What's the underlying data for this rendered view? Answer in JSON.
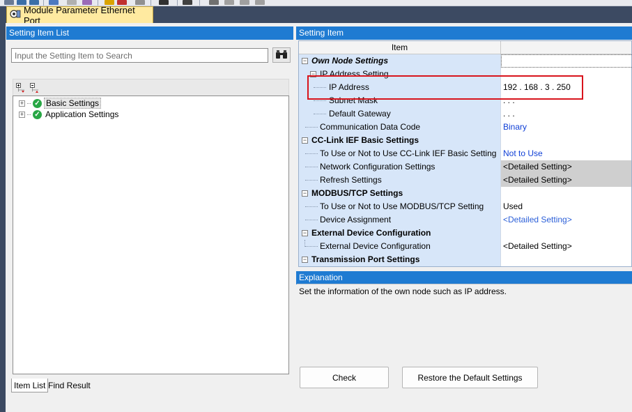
{
  "doc_tab": {
    "title": "Module Parameter Ethernet Port",
    "icon": "module-parameter-icon"
  },
  "left_panel": {
    "header": "Setting Item List",
    "search": {
      "placeholder": "Input the Setting Item to Search",
      "value": ""
    },
    "tree": [
      {
        "label": "Basic Settings",
        "selected": true
      },
      {
        "label": "Application Settings",
        "selected": false
      }
    ],
    "bottom_tabs": [
      {
        "label": "Item List",
        "active": true
      },
      {
        "label": "Find Result",
        "active": false
      }
    ]
  },
  "right_panel": {
    "header": "Setting Item",
    "column_item": "Item",
    "rows": [
      {
        "label": "Own Node Settings",
        "type": "category",
        "value": ""
      },
      {
        "label": "IP Address Setting",
        "type": "subcategory",
        "value": ""
      },
      {
        "label": "IP Address",
        "type": "item2",
        "value": "192 . 168 .   3 . 250"
      },
      {
        "label": "Subnet Mask",
        "type": "item2",
        "value": "  .     .     ."
      },
      {
        "label": "Default Gateway",
        "type": "item2",
        "value": "  .     .     ."
      },
      {
        "label": "Communication Data Code",
        "type": "item1",
        "value": "Binary"
      },
      {
        "label": "CC-Link IEF Basic Settings",
        "type": "category",
        "value": ""
      },
      {
        "label": "To Use or Not to Use CC-Link IEF Basic Setting",
        "type": "item1",
        "value": "Not to Use"
      },
      {
        "label": "Network Configuration Settings",
        "type": "item1",
        "value": "<Detailed Setting>"
      },
      {
        "label": "Refresh Settings",
        "type": "item1",
        "value": "<Detailed Setting>"
      },
      {
        "label": "MODBUS/TCP Settings",
        "type": "category",
        "value": ""
      },
      {
        "label": "To Use or Not to Use MODBUS/TCP Setting",
        "type": "item1",
        "value": "Used"
      },
      {
        "label": "Device Assignment",
        "type": "item1",
        "value": "<Detailed Setting>"
      },
      {
        "label": "External Device Configuration",
        "type": "category",
        "value": ""
      },
      {
        "label": "External Device Configuration",
        "type": "item1",
        "value": "<Detailed Setting>"
      },
      {
        "label": "Transmission Port Settings",
        "type": "category",
        "value": ""
      }
    ],
    "explanation_header": "Explanation",
    "explanation_text": "Set the information of the own node such as IP address.",
    "buttons": {
      "check": "Check",
      "restore": "Restore the Default Settings"
    }
  },
  "colors": {
    "header_blue": "#1f7bd2",
    "grid_label_bg": "#d7e6f9",
    "highlight_red": "#d8141c",
    "tab_yellow": "#ffeaa0"
  }
}
